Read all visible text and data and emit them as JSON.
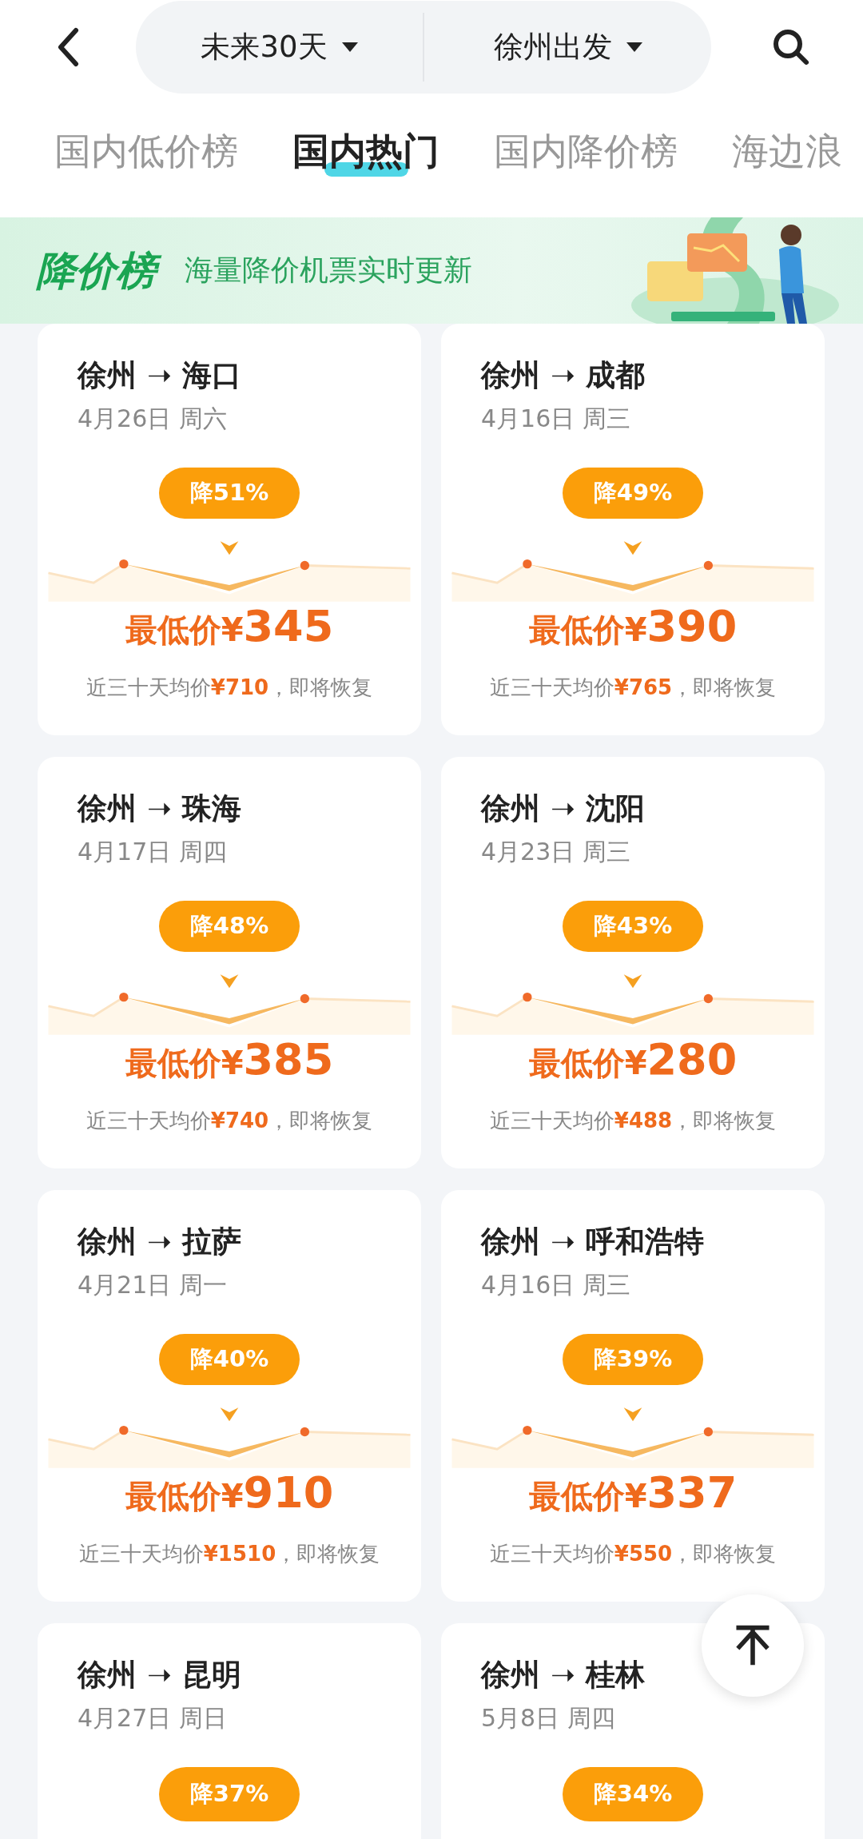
{
  "header": {
    "filters": [
      {
        "label": "未来30天"
      },
      {
        "label": "徐州出发"
      }
    ]
  },
  "tabs": [
    {
      "label": "国内低价榜",
      "selected": false
    },
    {
      "label": "国内热门",
      "selected": true
    },
    {
      "label": "国内降价榜",
      "selected": false
    },
    {
      "label": "海边浪",
      "selected": false
    }
  ],
  "banner": {
    "logo": "降价榜",
    "subtitle": "海量降价机票实时更新"
  },
  "cards": [
    {
      "route": "徐州 ➝ 海口",
      "date": "4月26日 周六",
      "badge": "降51%",
      "price_prefix": "最低价¥",
      "price": "345",
      "average": "近三十天均价**¥710**，即将恢复"
    },
    {
      "route": "徐州 ➝ 成都",
      "date": "4月16日 周三",
      "badge": "降49%",
      "price_prefix": "最低价¥",
      "price": "390",
      "average": "近三十天均价**¥765**，即将恢复"
    },
    {
      "route": "徐州 ➝ 珠海",
      "date": "4月17日 周四",
      "badge": "降48%",
      "price_prefix": "最低价¥",
      "price": "385",
      "average": "近三十天均价**¥740**，即将恢复"
    },
    {
      "route": "徐州 ➝ 沈阳",
      "date": "4月23日 周三",
      "badge": "降43%",
      "price_prefix": "最低价¥",
      "price": "280",
      "average": "近三十天均价**¥488**，即将恢复"
    },
    {
      "route": "徐州 ➝ 拉萨",
      "date": "4月21日 周一",
      "badge": "降40%",
      "price_prefix": "最低价¥",
      "price": "910",
      "average": "近三十天均价**¥1510**，即将恢复"
    },
    {
      "route": "徐州 ➝ 呼和浩特",
      "date": "4月16日 周三",
      "badge": "降39%",
      "price_prefix": "最低价¥",
      "price": "337",
      "average": "近三十天均价**¥550**，即将恢复"
    },
    {
      "route": "徐州 ➝ 昆明",
      "date": "4月27日 周日",
      "badge": "降37%"
    },
    {
      "route": "徐州 ➝ 桂林",
      "date": "5月8日 周四",
      "badge": "降34%"
    }
  ]
}
